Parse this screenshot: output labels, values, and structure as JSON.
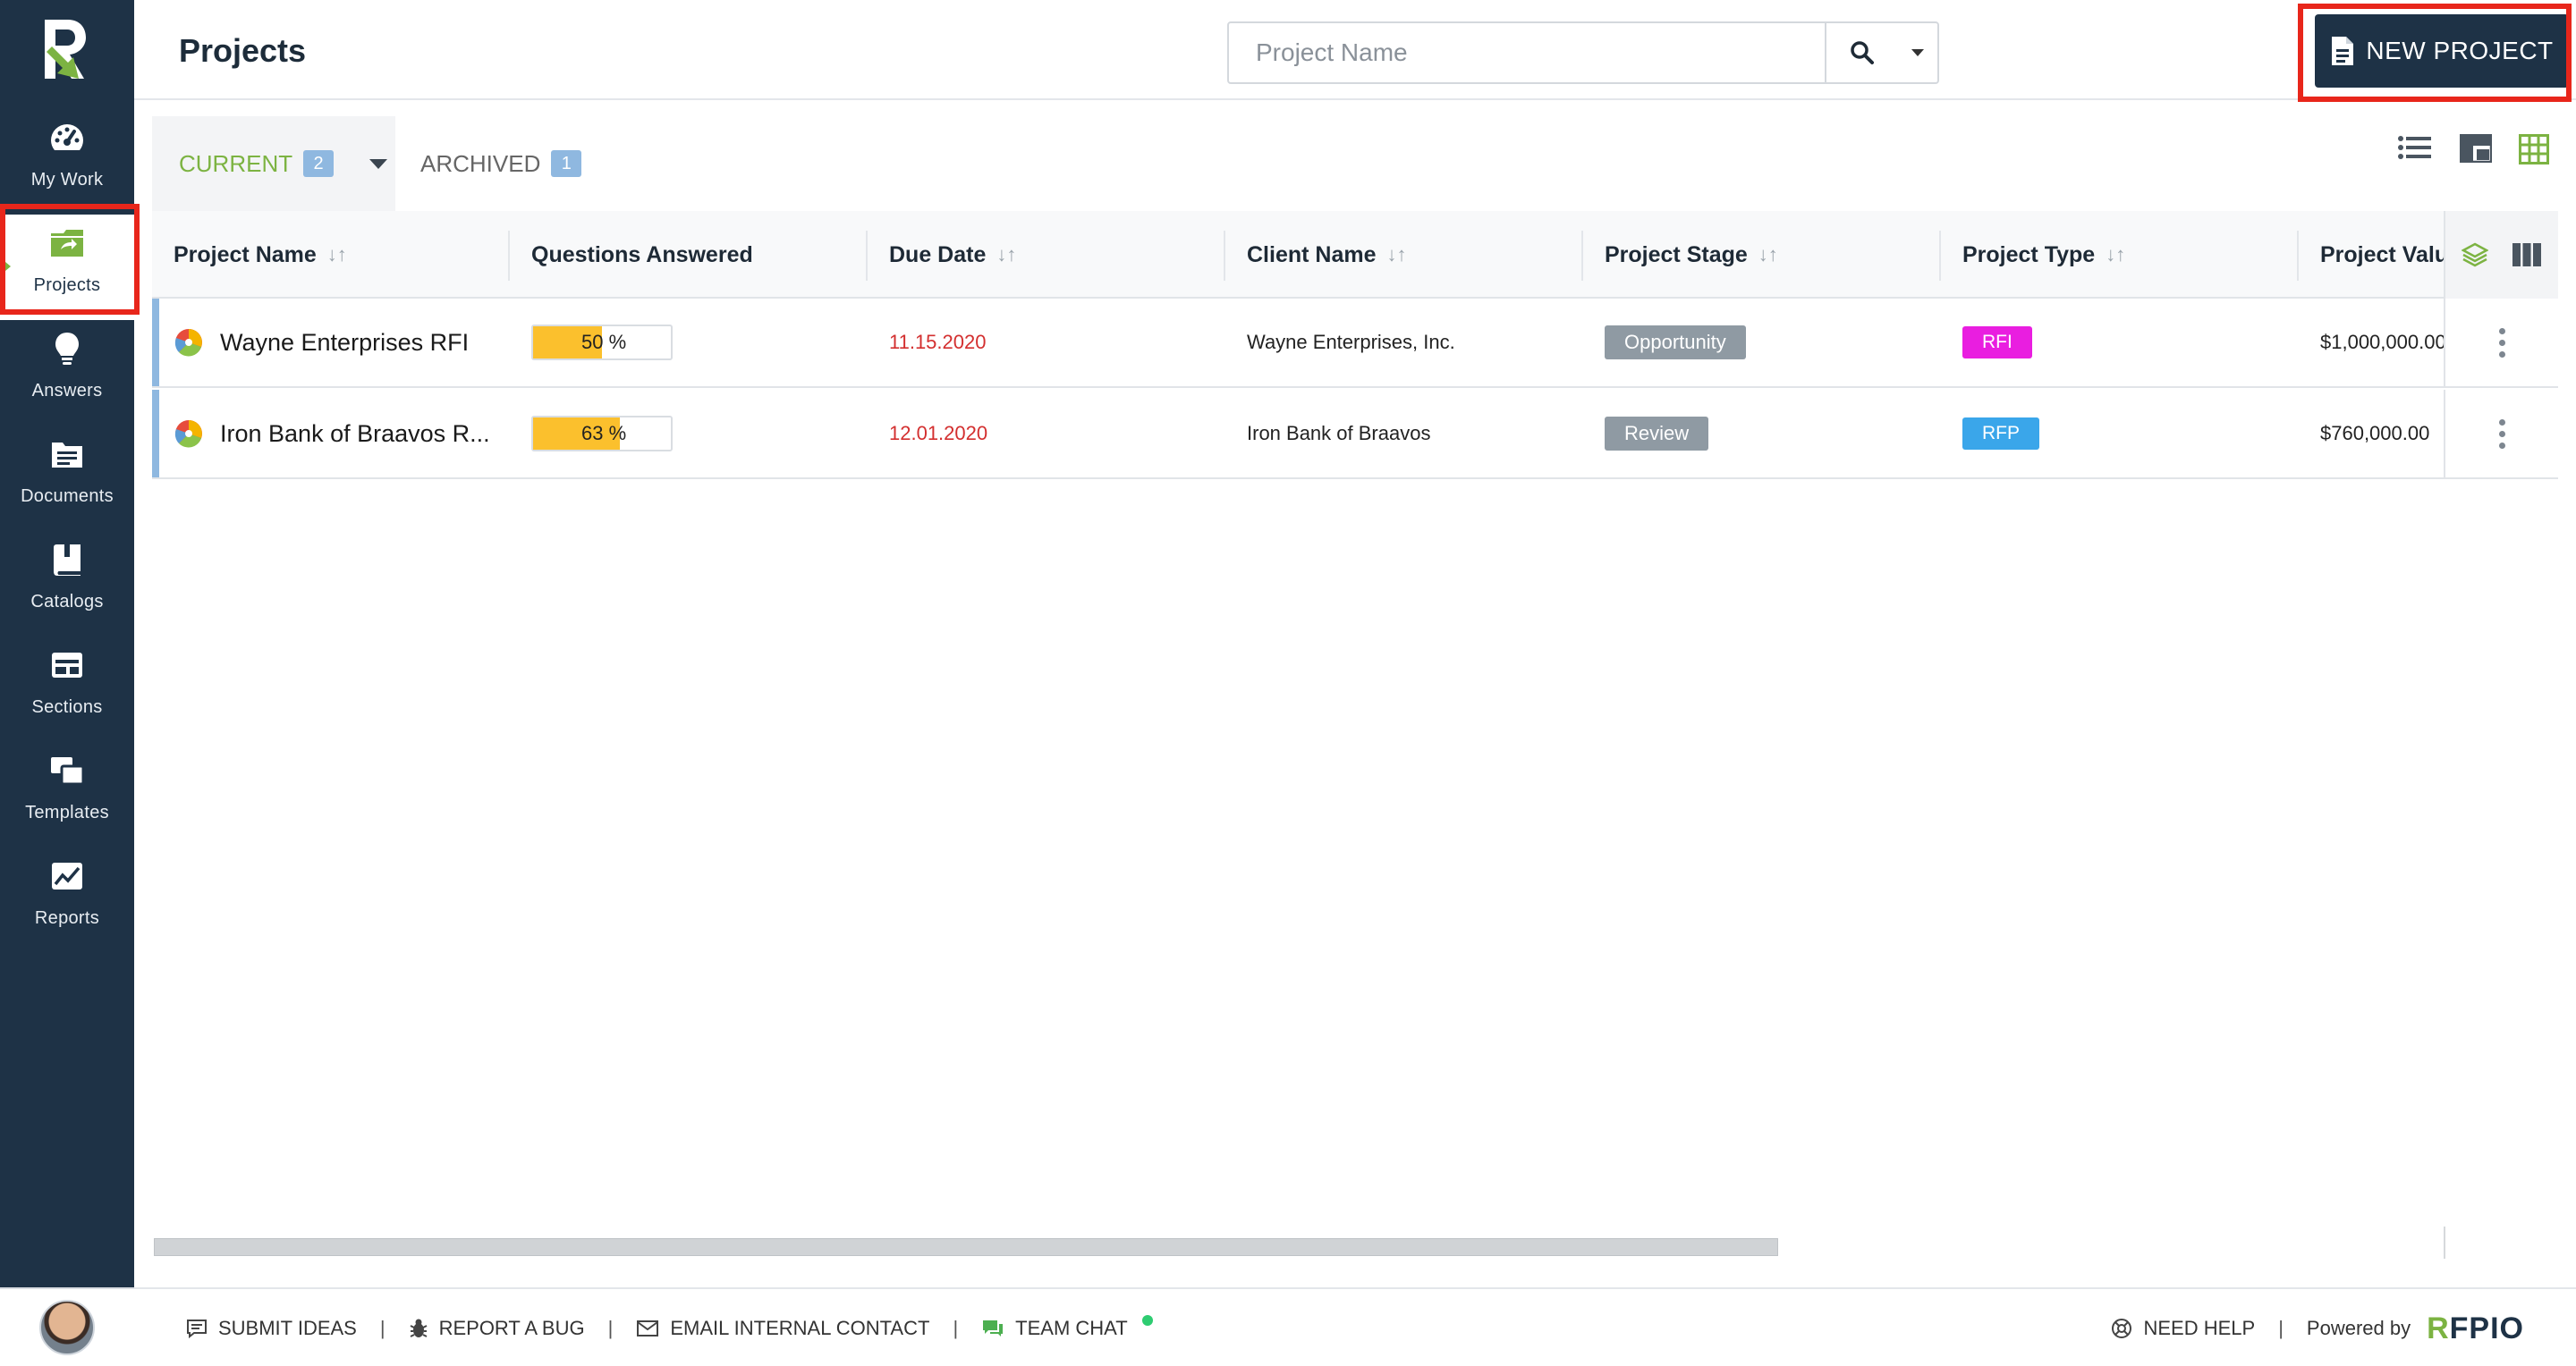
{
  "sidebar": {
    "items": [
      {
        "label": "My Work",
        "icon": "dashboard-gauge-icon"
      },
      {
        "label": "Projects",
        "icon": "projects-folder-icon"
      },
      {
        "label": "Answers",
        "icon": "lightbulb-icon"
      },
      {
        "label": "Documents",
        "icon": "documents-icon"
      },
      {
        "label": "Catalogs",
        "icon": "catalogs-book-icon"
      },
      {
        "label": "Sections",
        "icon": "sections-icon"
      },
      {
        "label": "Templates",
        "icon": "templates-icon"
      },
      {
        "label": "Reports",
        "icon": "reports-chart-icon"
      }
    ],
    "active_index": 1
  },
  "header": {
    "title": "Projects",
    "search_placeholder": "Project Name",
    "new_project_label": "NEW PROJECT"
  },
  "tabs": {
    "current_label": "CURRENT",
    "current_count": "2",
    "archived_label": "ARCHIVED",
    "archived_count": "1"
  },
  "table": {
    "columns": [
      "Project Name",
      "Questions Answered",
      "Due Date",
      "Client Name",
      "Project Stage",
      "Project Type",
      "Project Value"
    ],
    "rows": [
      {
        "name": "Wayne Enterprises RFI",
        "progress": 50,
        "progress_text": "50 %",
        "due_date": "11.15.2020",
        "client": "Wayne Enterprises, Inc.",
        "stage": "Opportunity",
        "type": "RFI",
        "type_color": "#e91ee0",
        "value": "$1,000,000.00"
      },
      {
        "name": "Iron Bank of Braavos R...",
        "progress": 63,
        "progress_text": "63 %",
        "due_date": "12.01.2020",
        "client": "Iron Bank of Braavos",
        "stage": "Review",
        "type": "RFP",
        "type_color": "#3aa6ea",
        "value": "$760,000.00"
      }
    ]
  },
  "footer": {
    "submit_ideas": "SUBMIT IDEAS",
    "report_bug": "REPORT A BUG",
    "email_contact": "EMAIL INTERNAL CONTACT",
    "team_chat": "TEAM CHAT",
    "need_help": "NEED HELP",
    "powered_by": "Powered by",
    "brand_r": "R",
    "brand_rest": "FPIO"
  },
  "colors": {
    "sidebar_bg": "#1e3246",
    "accent_green": "#7cb342",
    "highlight_red": "#e8261b",
    "due_red": "#d32f2f",
    "progress_yellow": "#fbc02d"
  }
}
